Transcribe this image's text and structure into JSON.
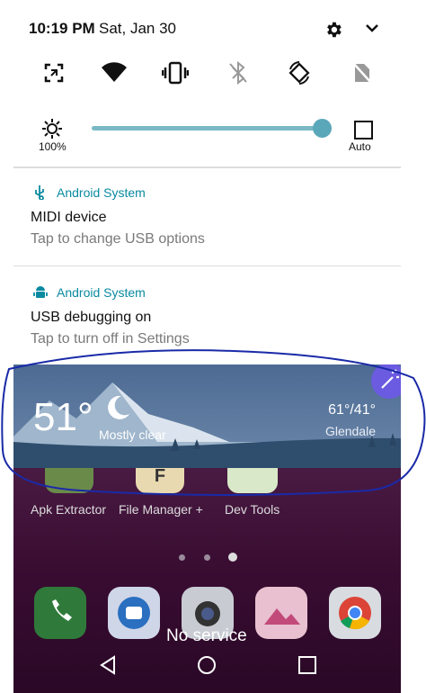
{
  "status": {
    "time": "10:19 PM",
    "date": "Sat, Jan 30"
  },
  "brightness": {
    "level_label": "100%",
    "auto_label": "Auto",
    "level_fraction": 1.0
  },
  "notifications": [
    {
      "app": "Android System",
      "title": "MIDI device",
      "subtitle": "Tap to change USB options",
      "icon": "usb-icon"
    },
    {
      "app": "Android System",
      "title": "USB debugging on",
      "subtitle": "Tap to turn off in Settings",
      "icon": "android-icon"
    }
  ],
  "weather": {
    "temp": "51°",
    "condition": "Mostly clear",
    "hilo": "61°/41°",
    "city": "Glendale"
  },
  "apps": [
    {
      "label": "Apk Extractor"
    },
    {
      "label": "File Manager +"
    },
    {
      "label": "Dev Tools"
    }
  ],
  "service_text": "No service",
  "colors": {
    "accent": "#0a8aa0",
    "slider": "#5aa7b9",
    "annotation": "#1a2aa8"
  }
}
